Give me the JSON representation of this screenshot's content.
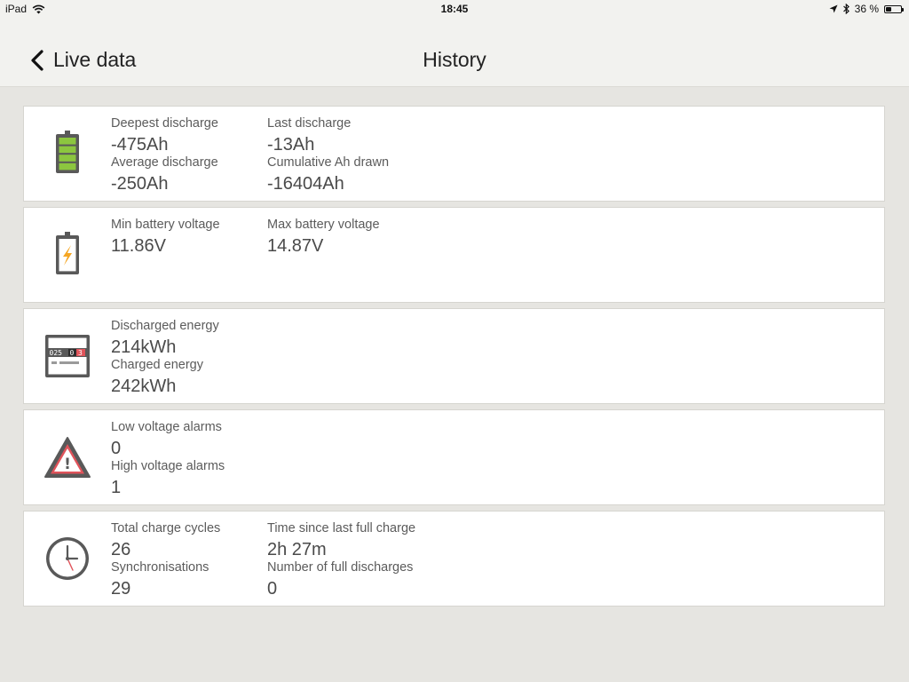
{
  "statusbar": {
    "device": "iPad",
    "time": "18:45",
    "battery_percent": "36 %",
    "battery_level": 0.36
  },
  "navbar": {
    "back_label": "Live data",
    "title": "History"
  },
  "cards": {
    "discharge": {
      "deepest_label": "Deepest discharge",
      "deepest_value": "-475Ah",
      "last_label": "Last discharge",
      "last_value": "-13Ah",
      "average_label": "Average discharge",
      "average_value": "-250Ah",
      "cumulative_label": "Cumulative Ah drawn",
      "cumulative_value": "-16404Ah"
    },
    "voltage": {
      "min_label": "Min battery voltage",
      "min_value": "11.86V",
      "max_label": "Max battery voltage",
      "max_value": "14.87V"
    },
    "energy": {
      "meter_digits": "025",
      "meter_digit_dark": "0",
      "meter_digit_red": "3",
      "discharged_label": "Discharged energy",
      "discharged_value": "214kWh",
      "charged_label": "Charged energy",
      "charged_value": "242kWh"
    },
    "alarms": {
      "icon_glyph": "!",
      "low_label": "Low voltage alarms",
      "low_value": "0",
      "high_label": "High voltage alarms",
      "high_value": "1"
    },
    "cycles": {
      "total_label": "Total charge cycles",
      "total_value": "26",
      "time_label": "Time since last full charge",
      "time_value": "2h 27m",
      "sync_label": "Synchronisations",
      "sync_value": "29",
      "full_label": "Number of full discharges",
      "full_value": "0"
    }
  },
  "colors": {
    "battery_green": "#8cc63f",
    "warning_red": "#e0535a",
    "bolt_orange": "#f5a623",
    "icon_gray": "#595959"
  }
}
